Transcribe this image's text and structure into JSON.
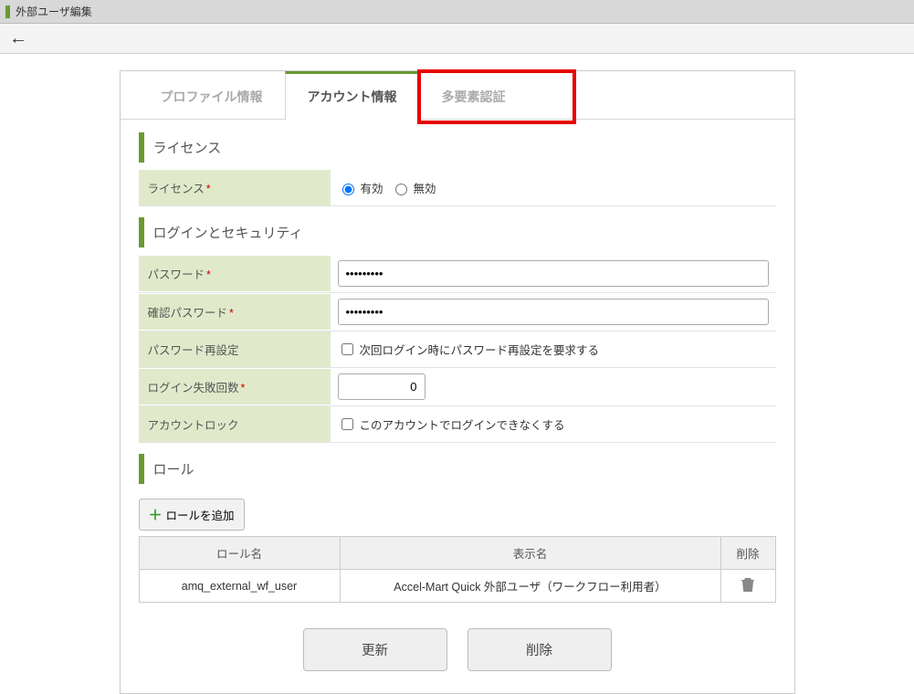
{
  "header": {
    "title": "外部ユーザ編集"
  },
  "tabs": {
    "profile": "プロファイル情報",
    "account": "アカウント情報",
    "mfa": "多要素認証"
  },
  "sections": {
    "license": "ライセンス",
    "login_sec": "ログインとセキュリティ",
    "role": "ロール"
  },
  "license": {
    "label": "ライセンス",
    "opt_valid": "有効",
    "opt_invalid": "無効"
  },
  "login": {
    "password_label": "パスワード",
    "confirm_label": "確認パスワード",
    "reset_label": "パスワード再設定",
    "reset_chk": "次回ログイン時にパスワード再設定を要求する",
    "fail_count_label": "ログイン失敗回数",
    "fail_count_value": "0",
    "lock_label": "アカウントロック",
    "lock_chk": "このアカウントでログインできなくする",
    "dots": "•••••••••"
  },
  "role": {
    "add_btn": "ロールを追加",
    "col_name": "ロール名",
    "col_disp": "表示名",
    "col_del": "削除",
    "rows": [
      {
        "name": "amq_external_wf_user",
        "disp": "Accel-Mart Quick 外部ユーザ（ワークフロー利用者）"
      }
    ]
  },
  "buttons": {
    "update": "更新",
    "delete": "削除"
  }
}
